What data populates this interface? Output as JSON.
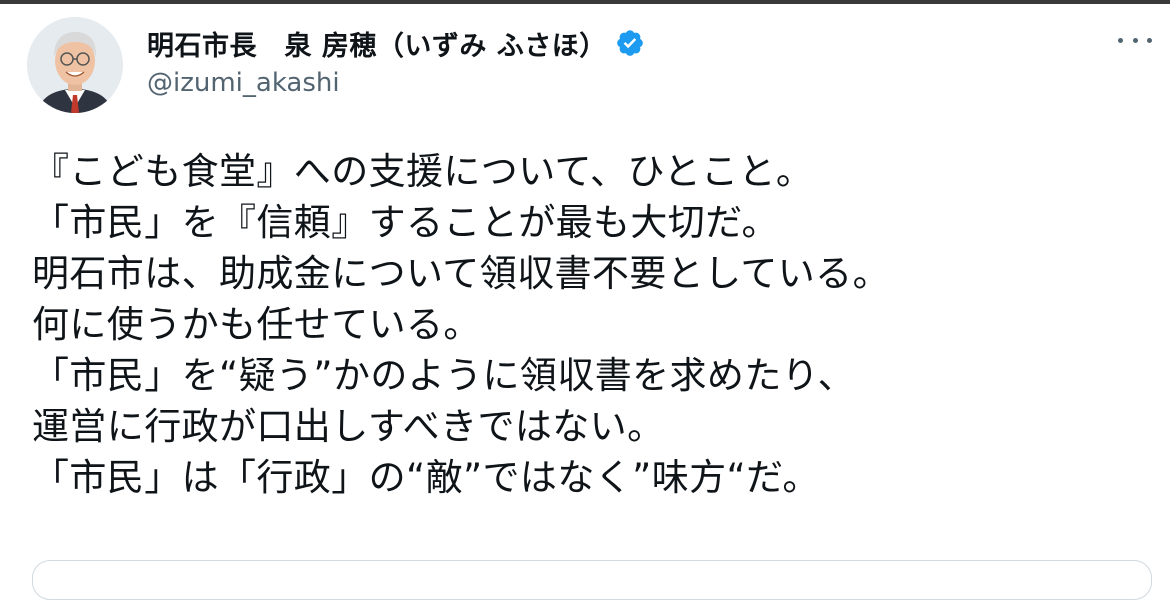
{
  "author": {
    "display_name": "明石市長　泉 房穂（いずみ ふさほ）",
    "handle": "@izumi_akashi",
    "verified": true,
    "verified_color": "#1d9bf0",
    "avatar_icon": "profile-photo"
  },
  "more_icon": "ellipsis-icon",
  "tweet": {
    "lines": [
      "『こども食堂』への支援について、ひとこと。",
      "「市民」を『信頼』することが最も大切だ。",
      "明石市は、助成金について領収書不要としている。",
      "何に使うかも任せている。",
      "「市民」を“疑う”かのように領収書を求めたり、",
      "運営に行政が口出しすべきではない。",
      "「市民」は「行政」の“敵”ではなく”味方“だ。"
    ]
  },
  "colors": {
    "text": "#0f1419",
    "secondary_text": "#536471",
    "border": "#cfd9de"
  }
}
